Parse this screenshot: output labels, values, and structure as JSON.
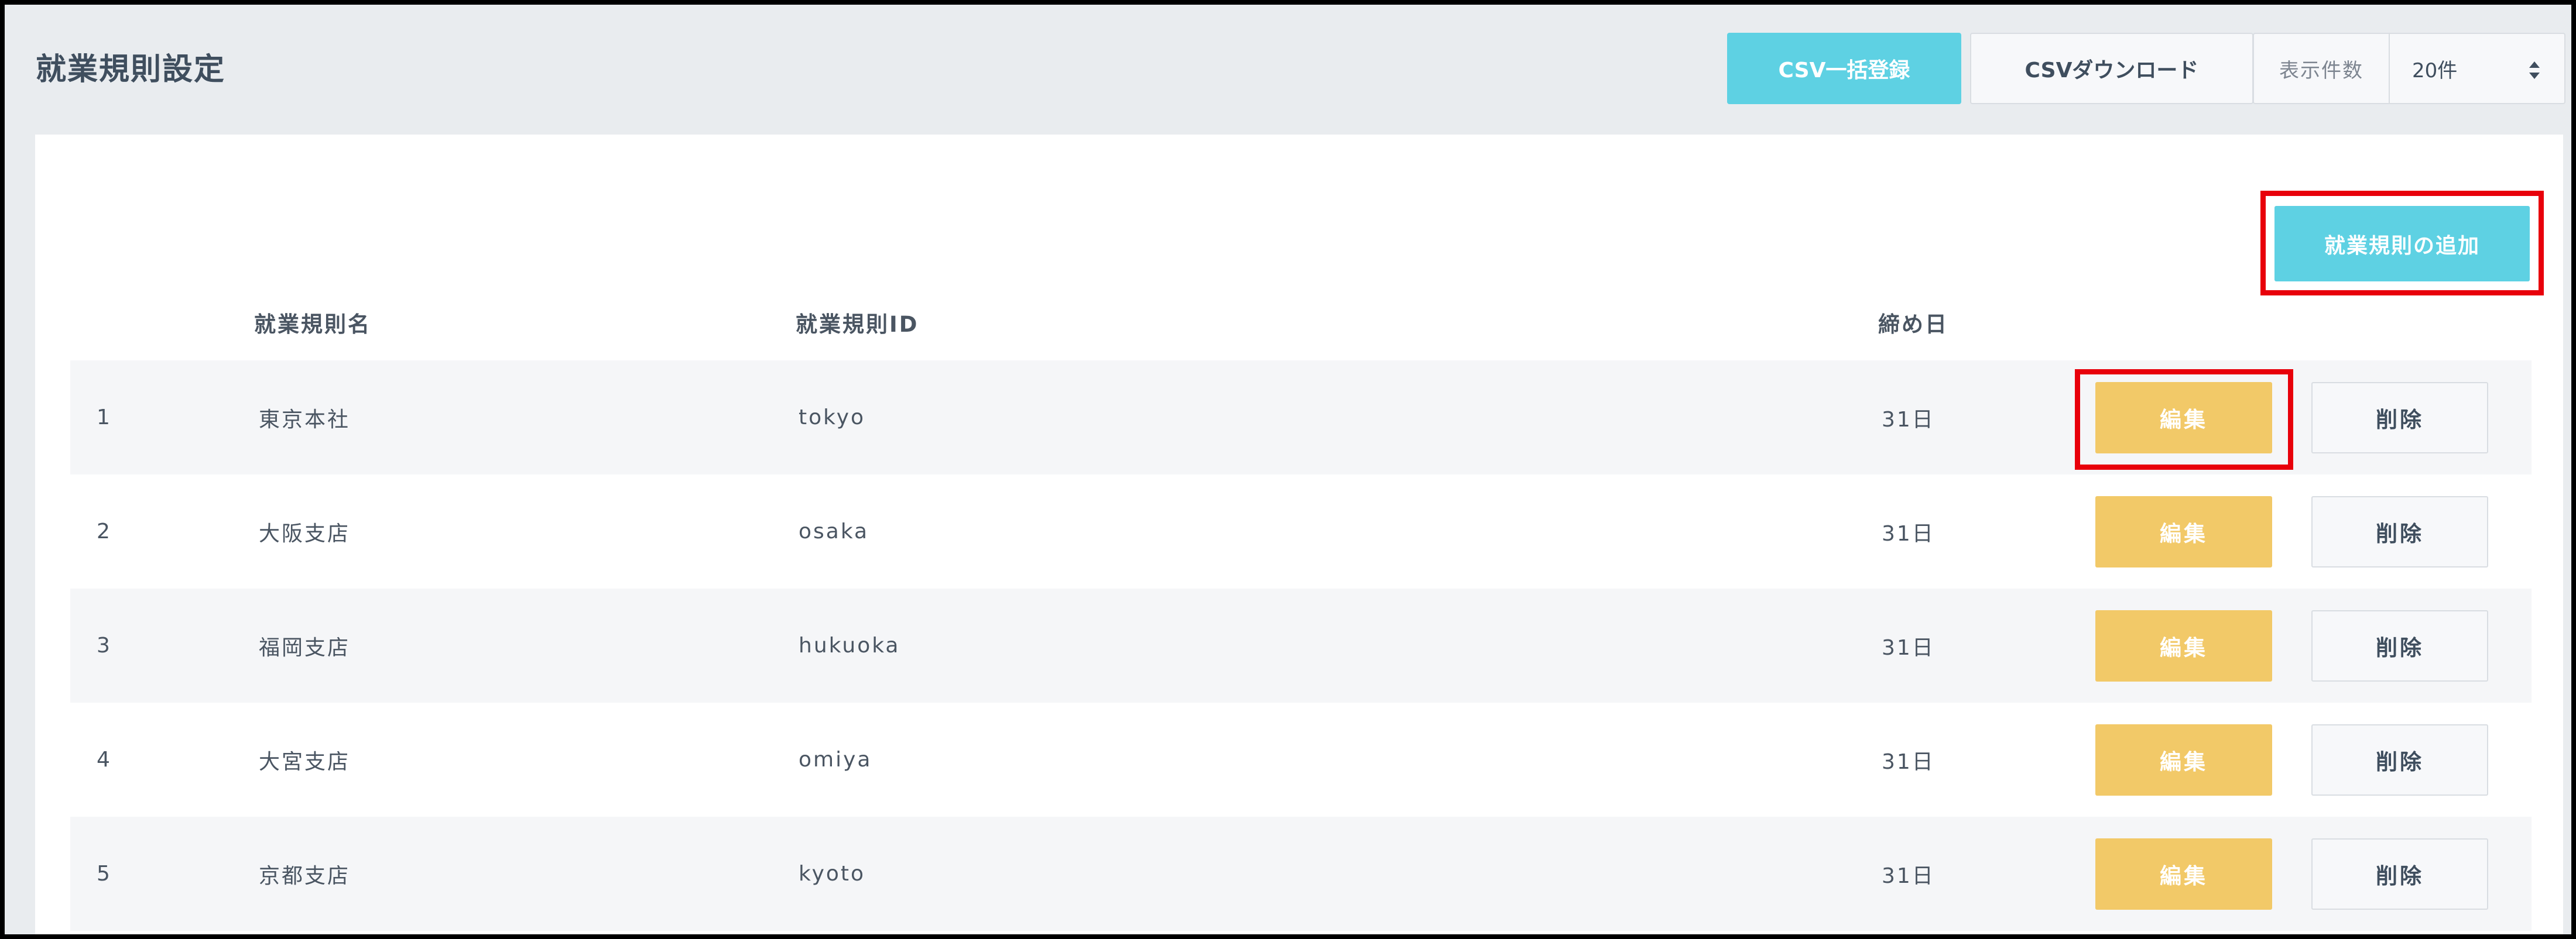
{
  "header": {
    "title": "就業規則設定",
    "csv_upload_label": "CSV一括登録",
    "csv_download_label": "CSVダウンロード",
    "per_page_label": "表示件数",
    "per_page_value": "20件"
  },
  "main": {
    "add_button_label": "就業規則の追加",
    "columns": {
      "name": "就業規則名",
      "id": "就業規則ID",
      "closing": "締め日"
    },
    "edit_label": "編集",
    "delete_label": "削除",
    "rows": [
      {
        "no": "1",
        "name": "東京本社",
        "id": "tokyo",
        "closing": "31日"
      },
      {
        "no": "2",
        "name": "大阪支店",
        "id": "osaka",
        "closing": "31日"
      },
      {
        "no": "3",
        "name": "福岡支店",
        "id": "hukuoka",
        "closing": "31日"
      },
      {
        "no": "4",
        "name": "大宮支店",
        "id": "omiya",
        "closing": "31日"
      },
      {
        "no": "5",
        "name": "京都支店",
        "id": "kyoto",
        "closing": "31日"
      }
    ]
  },
  "colors": {
    "accent_cyan": "#5ed1e3",
    "edit_yellow": "#f2c968",
    "highlight_red": "#e8000b",
    "row_shade": "#f5f6f8"
  }
}
